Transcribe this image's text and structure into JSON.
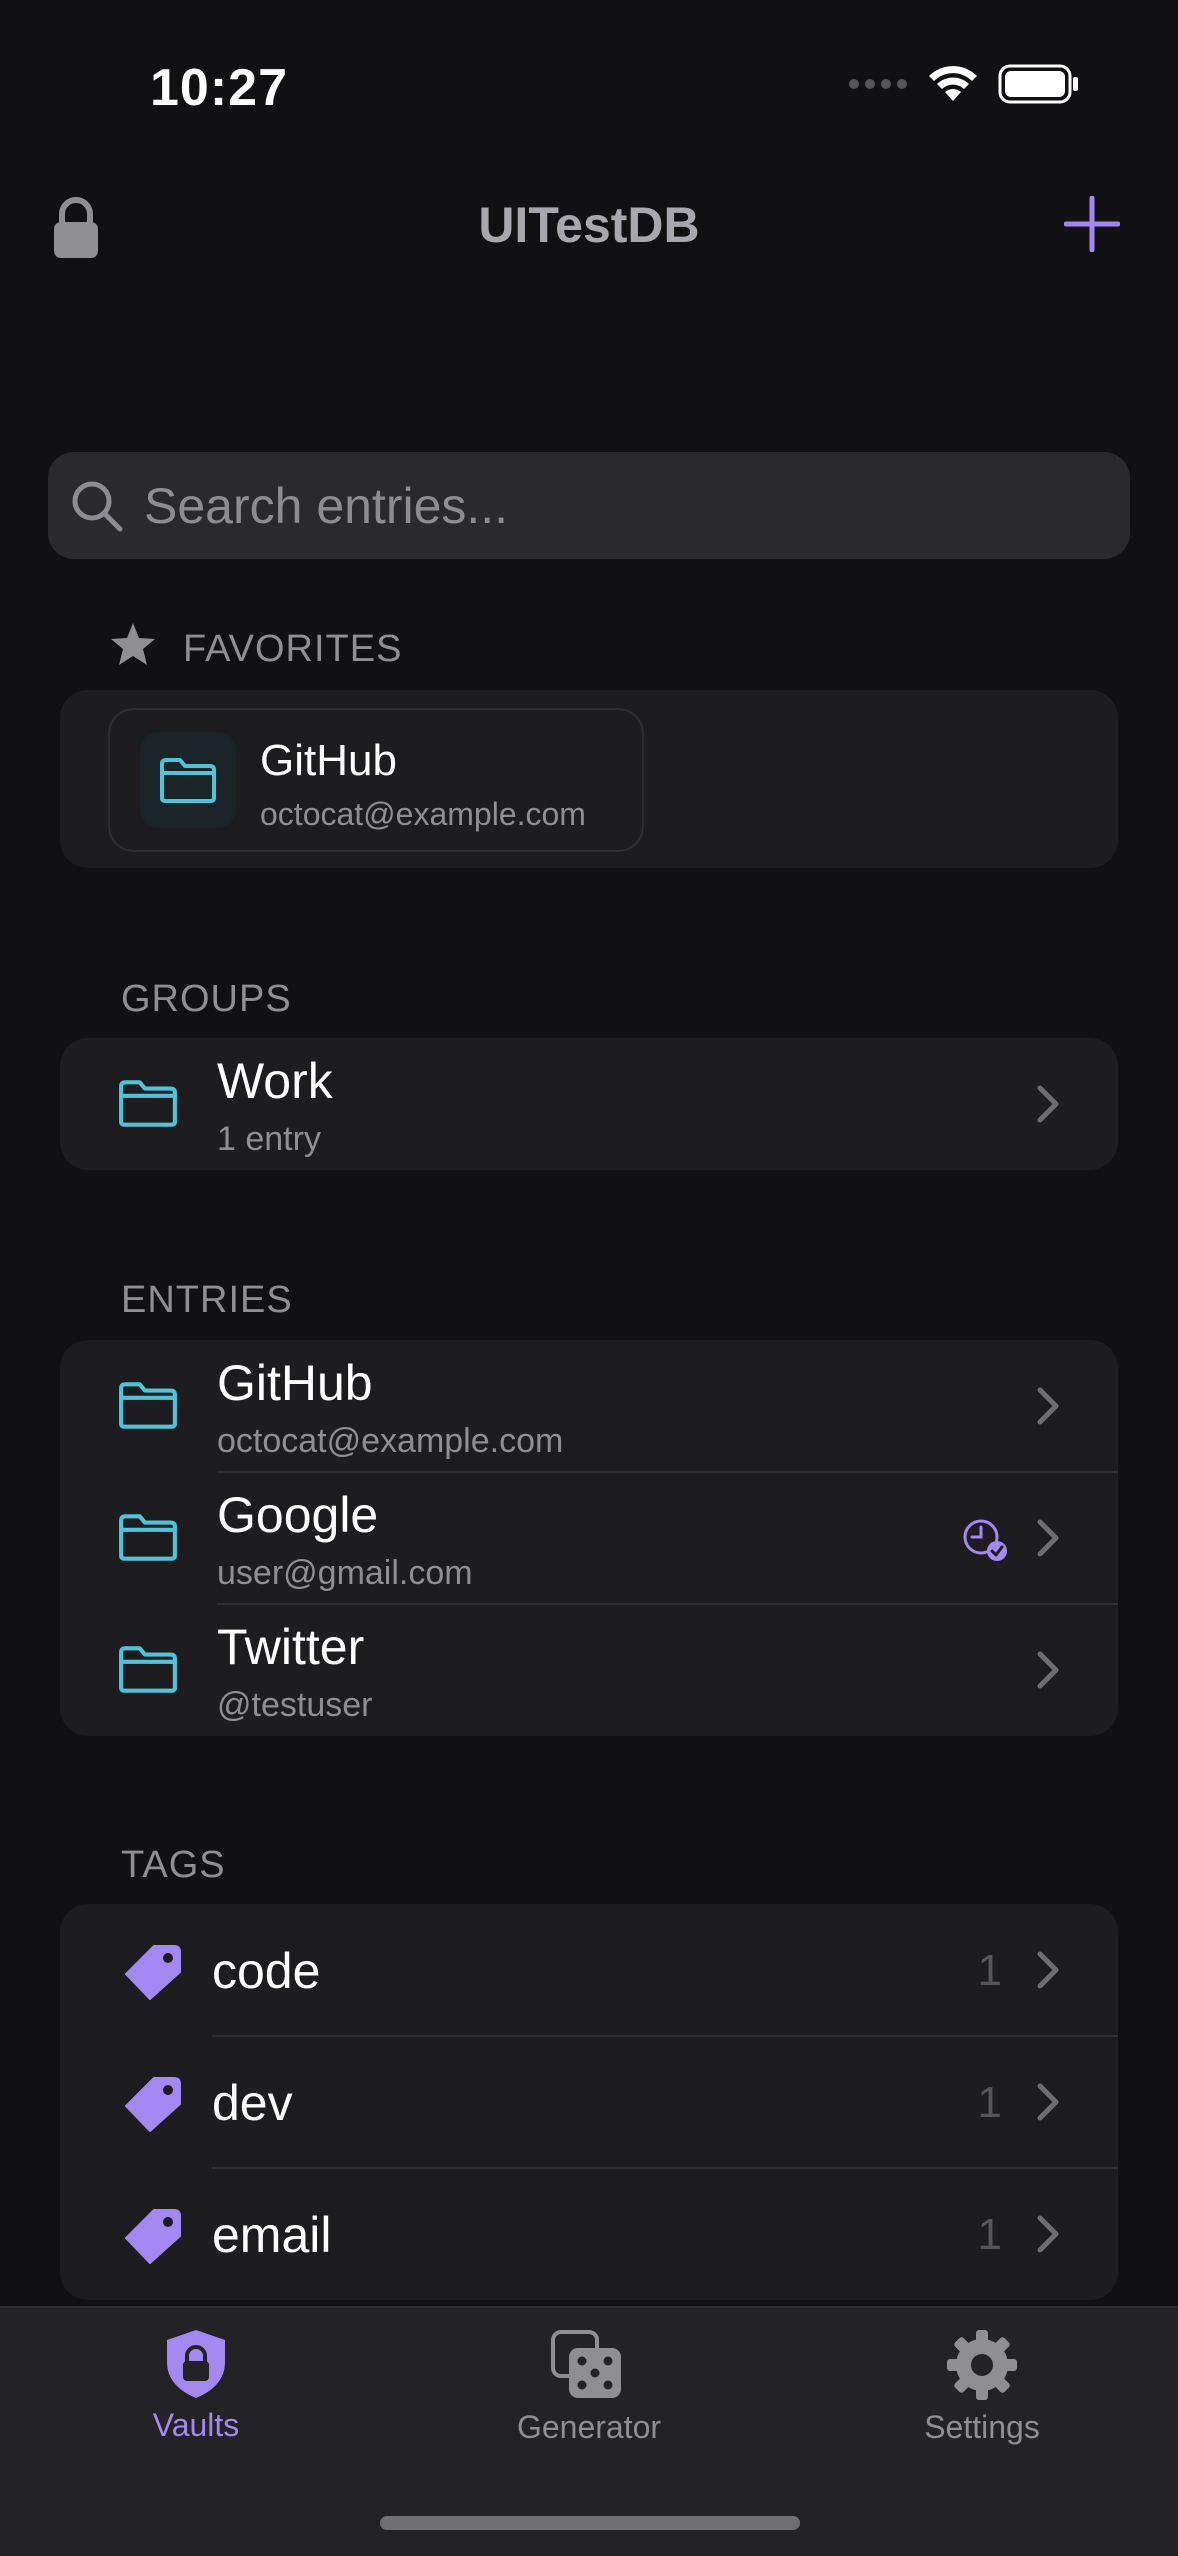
{
  "status_bar": {
    "time": "10:27"
  },
  "nav": {
    "title": "UITestDB"
  },
  "search": {
    "placeholder": "Search entries..."
  },
  "favorites": {
    "header": "FAVORITES",
    "items": [
      {
        "title": "GitHub",
        "subtitle": "octocat@example.com"
      }
    ]
  },
  "groups": {
    "header": "GROUPS",
    "items": [
      {
        "title": "Work",
        "subtitle": "1 entry"
      }
    ]
  },
  "entries": {
    "header": "ENTRIES",
    "items": [
      {
        "title": "GitHub",
        "subtitle": "octocat@example.com"
      },
      {
        "title": "Google",
        "subtitle": "user@gmail.com",
        "badge_icon": "clock-check-icon"
      },
      {
        "title": "Twitter",
        "subtitle": "@testuser"
      }
    ]
  },
  "tags": {
    "header": "TAGS",
    "items": [
      {
        "label": "code",
        "count": "1"
      },
      {
        "label": "dev",
        "count": "1"
      },
      {
        "label": "email",
        "count": "1"
      }
    ]
  },
  "tabbar": {
    "items": [
      {
        "label": "Vaults",
        "icon": "shield-lock-icon",
        "active": true
      },
      {
        "label": "Generator",
        "icon": "dice-icon",
        "active": false
      },
      {
        "label": "Settings",
        "icon": "gear-icon",
        "active": false
      }
    ]
  },
  "colors": {
    "accent": "#a488f2",
    "folder": "#4fc3d9",
    "background": "#111113",
    "card": "#1d1d1f",
    "secondary_text": "#8e8e93"
  }
}
